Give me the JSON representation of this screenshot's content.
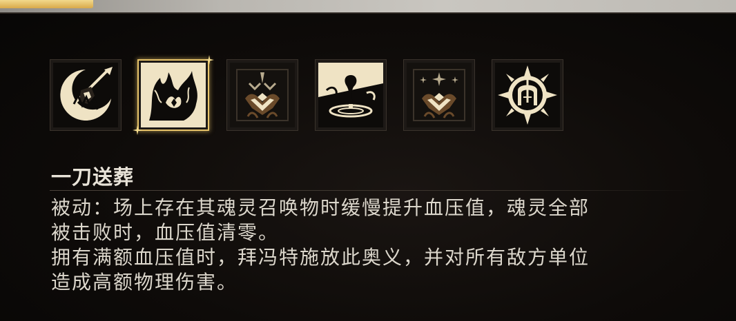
{
  "skills": {
    "selected_index": 1,
    "icons": [
      {
        "name": "crescent-moon-spear-icon"
      },
      {
        "name": "flaming-spirit-icon"
      },
      {
        "name": "chevron-crest-icon"
      },
      {
        "name": "splash-drop-icon"
      },
      {
        "name": "chevron-crest-sparkle-icon"
      },
      {
        "name": "spiked-sun-gate-icon"
      }
    ]
  },
  "skill_detail": {
    "title": "一刀送葬",
    "description_lines": [
      "被动：场上存在其魂灵召唤物时缓慢提升血压值，魂灵全部",
      "被击败时，血压值清零。",
      "拥有满额血压值时，拜冯特施放此奥义，并对所有敌方单位",
      "造成高额物理伤害。"
    ]
  },
  "colors": {
    "accent_gold": "#e9c56a",
    "icon_cream": "#efe3c4",
    "text": "#dcd7cc",
    "background": "#0b0908"
  }
}
